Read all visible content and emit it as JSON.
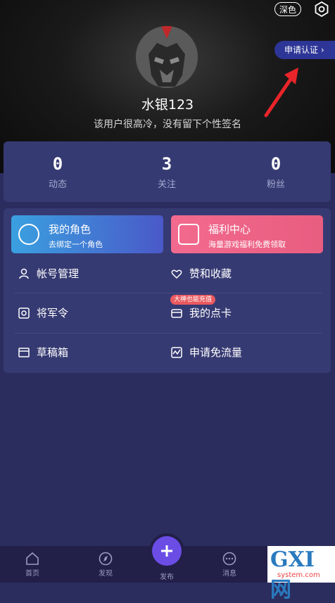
{
  "header": {
    "theme_toggle": "深色",
    "apply_cert": "申请认证"
  },
  "profile": {
    "name": "水银123",
    "bio": "该用户很高冷，没有留下个性签名"
  },
  "stats": [
    {
      "value": "0",
      "label": "动态"
    },
    {
      "value": "3",
      "label": "关注"
    },
    {
      "value": "0",
      "label": "粉丝"
    }
  ],
  "cards": {
    "role": {
      "title": "我的角色",
      "subtitle": "去绑定一个角色",
      "color": "#4a59c8"
    },
    "welfare": {
      "title": "福利中心",
      "subtitle": "海量游戏福利免费领取",
      "color": "#e85d80"
    }
  },
  "menu": {
    "account": "帐号管理",
    "favorites": "赞和收藏",
    "token": "将军令",
    "cards": "我的点卡",
    "badge": "大神也能充值",
    "drafts": "草稿箱",
    "free_traffic": "申请免流量"
  },
  "tabs": {
    "home": "首页",
    "discover": "发现",
    "publish": "发布",
    "messages": "消息"
  },
  "watermark": {
    "logo": "GXI网",
    "domain": "system.com"
  }
}
